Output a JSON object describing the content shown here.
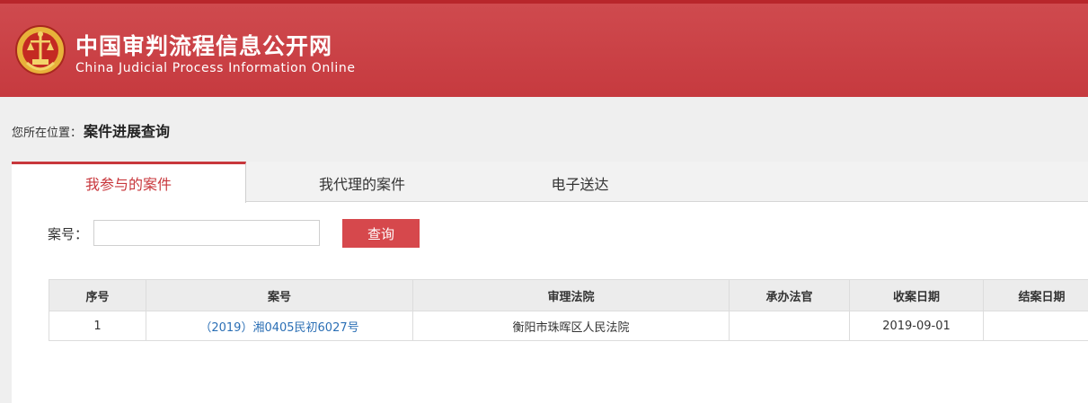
{
  "header": {
    "title": "中国审判流程信息公开网",
    "subtitle": "China Judicial Process Information Online",
    "emblem_icon": "court-emblem-icon",
    "colors": {
      "brand_red": "#c8373c",
      "link_blue": "#2b6fb5"
    }
  },
  "breadcrumb": {
    "label": "您所在位置：",
    "current": "案件进展查询"
  },
  "tabs": [
    {
      "label": "我参与的案件",
      "active": true
    },
    {
      "label": "我代理的案件",
      "active": false
    },
    {
      "label": "电子送达",
      "active": false
    }
  ],
  "search": {
    "label": "案号：",
    "value": "",
    "button_label": "查询"
  },
  "table": {
    "columns": [
      "序号",
      "案号",
      "审理法院",
      "承办法官",
      "收案日期",
      "结案日期"
    ],
    "rows": [
      [
        "1",
        "（2019）湘0405民初6027号",
        "衡阳市珠晖区人民法院",
        "",
        "2019-09-01",
        ""
      ]
    ]
  }
}
